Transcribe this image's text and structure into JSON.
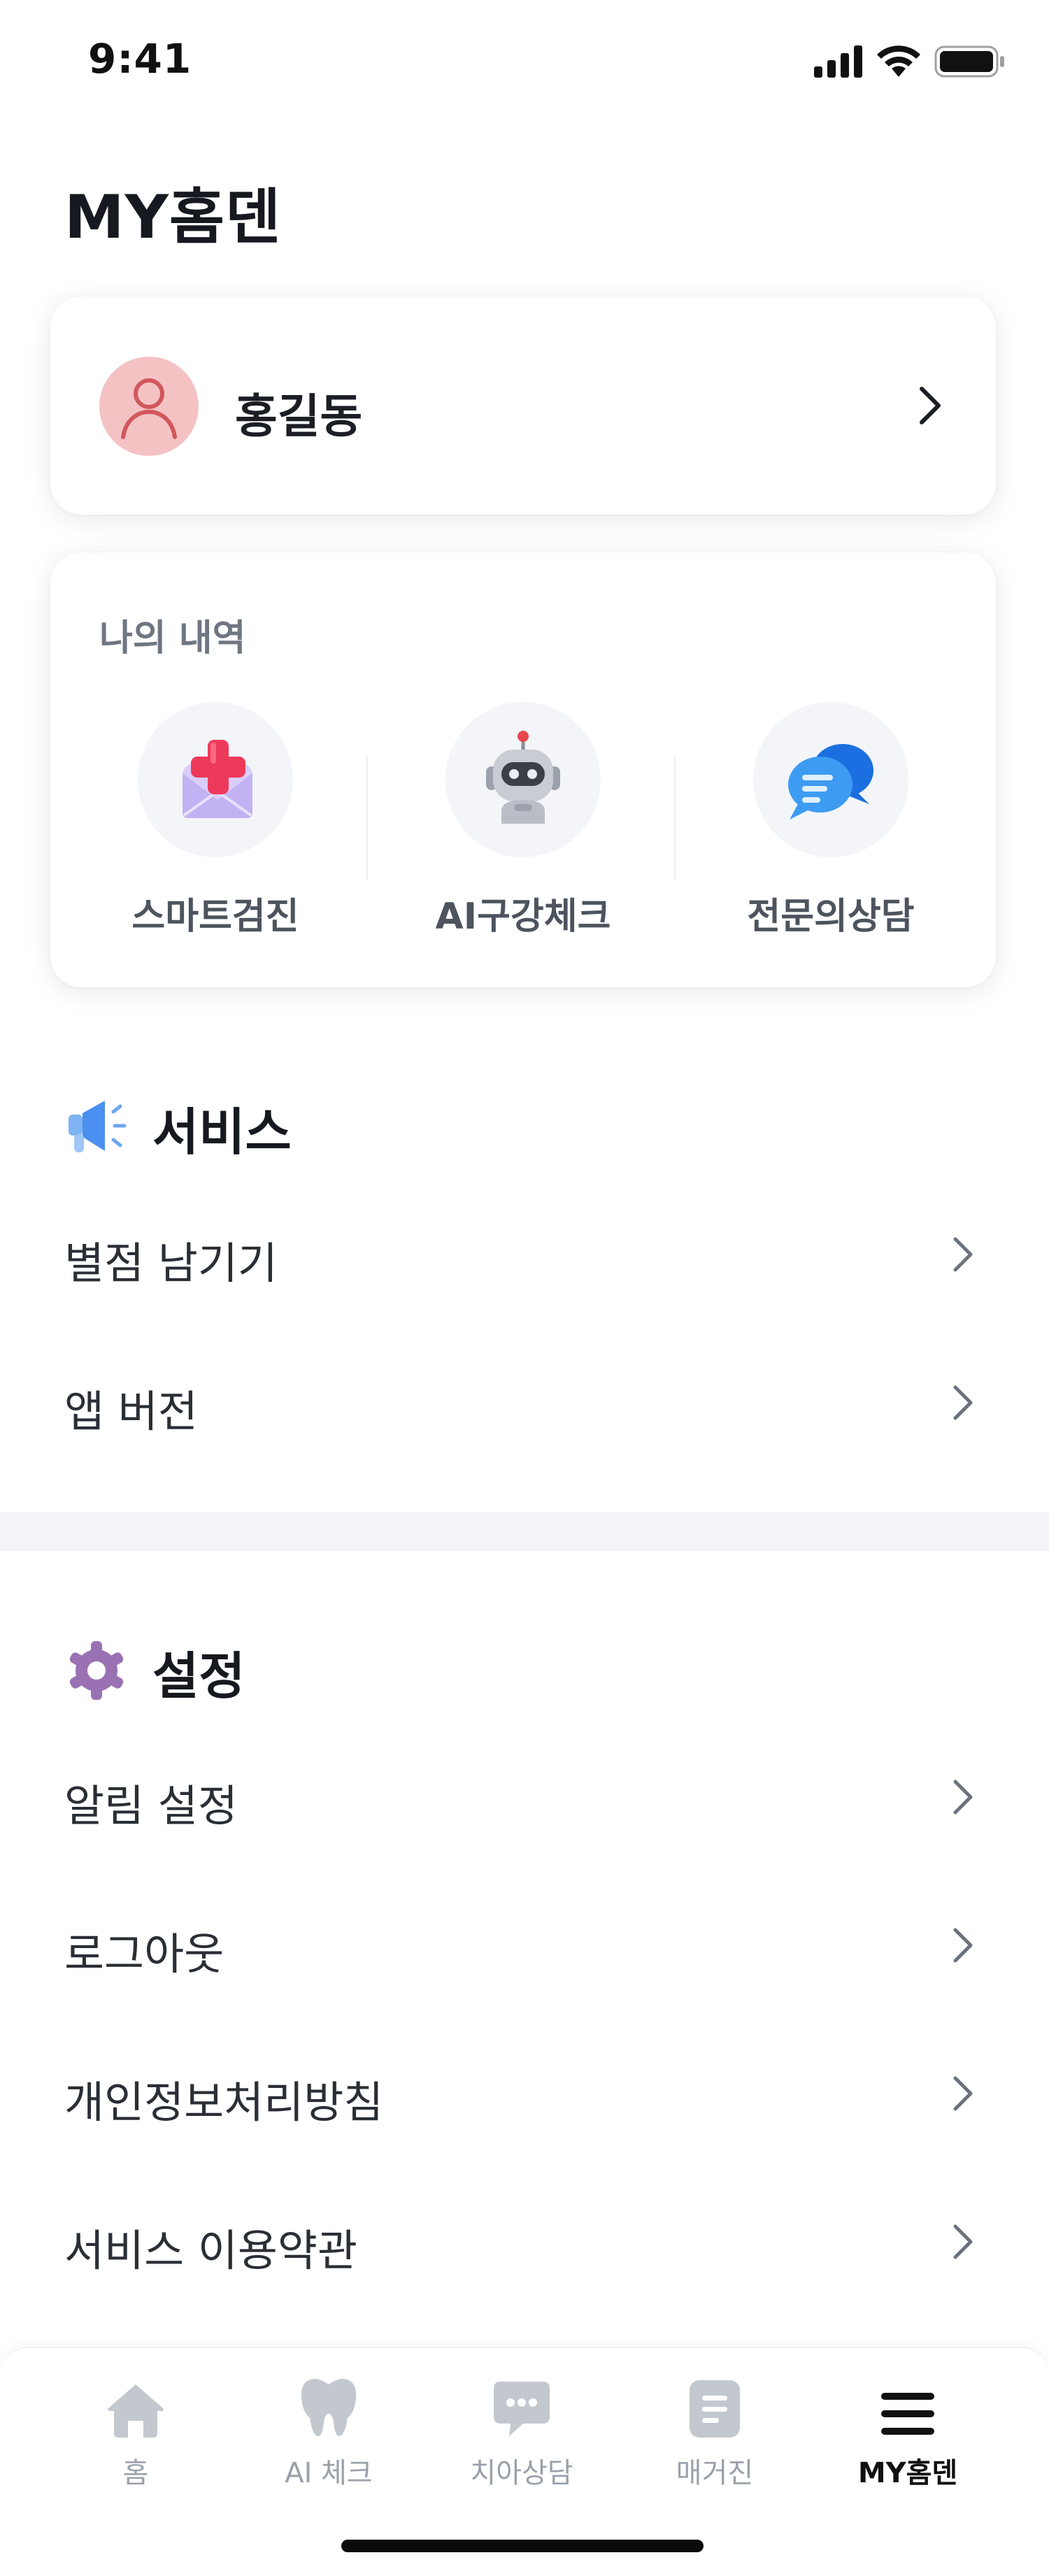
{
  "status_bar": {
    "time": "9:41"
  },
  "page_title": "MY홈덴",
  "profile": {
    "name": "홍길동"
  },
  "history": {
    "title": "나의 내역",
    "items": [
      {
        "label": "스마트검진",
        "icon": "envelope-medical-cross-icon"
      },
      {
        "label": "AI구강체크",
        "icon": "robot-icon"
      },
      {
        "label": "전문의상담",
        "icon": "chat-bubbles-icon"
      }
    ]
  },
  "service_section": {
    "title": "서비스",
    "icon": "megaphone-icon",
    "items": [
      {
        "label": "별점 남기기"
      },
      {
        "label": "앱 버전"
      }
    ]
  },
  "settings_section": {
    "title": "설정",
    "icon": "gear-icon",
    "items": [
      {
        "label": "알림 설정"
      },
      {
        "label": "로그아웃"
      },
      {
        "label": "개인정보처리방침"
      },
      {
        "label": "서비스 이용약관"
      }
    ]
  },
  "tab_bar": {
    "tabs": [
      {
        "label": "홈",
        "icon": "home-icon"
      },
      {
        "label": "AI 체크",
        "icon": "tooth-icon"
      },
      {
        "label": "치아상담",
        "icon": "chat-icon"
      },
      {
        "label": "매거진",
        "icon": "document-icon"
      },
      {
        "label": "MY홈덴",
        "icon": "menu-icon",
        "active": true
      }
    ]
  },
  "colors": {
    "accent_tab_active": "#111111",
    "tab_inactive": "#c3c8cf",
    "avatar_bg": "#f5c2c4",
    "settings_icon": "#9a72b3",
    "service_icon": "#6ea6ee"
  }
}
